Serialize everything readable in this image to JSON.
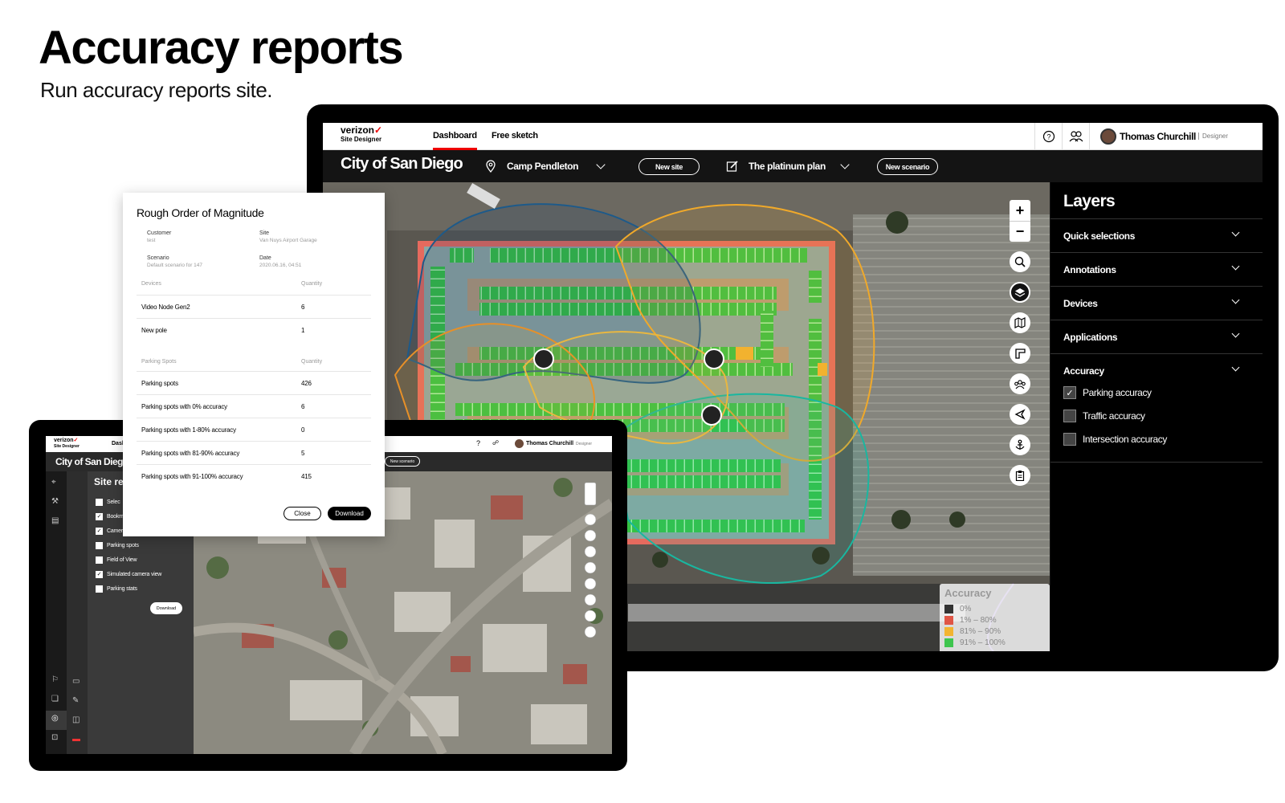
{
  "hero": {
    "title": "Accuracy reports",
    "subtitle": "Run accuracy reports site."
  },
  "main_app": {
    "logo": {
      "brand": "verizon",
      "product": "Site Designer"
    },
    "nav": [
      {
        "label": "Dashboard",
        "active": true
      },
      {
        "label": "Free sketch",
        "active": false
      }
    ],
    "icons": [
      "help-icon",
      "users-icon"
    ],
    "user": {
      "name": "Thomas Churchill",
      "role": "Designer"
    },
    "city": "City of San Diego",
    "site": "Camp Pendleton",
    "new_site_label": "New site",
    "plan": "The platinum plan",
    "new_scenario_label": "New scenario",
    "layers": {
      "title": "Layers",
      "sections": [
        "Quick selections",
        "Annotations",
        "Devices",
        "Applications",
        "Accuracy"
      ],
      "accuracy_options": [
        {
          "label": "Parking accuracy",
          "checked": true
        },
        {
          "label": "Traffic accuracy",
          "checked": false
        },
        {
          "label": "Intersection accuracy",
          "checked": false
        }
      ]
    },
    "legend": {
      "title": "Accuracy",
      "items": [
        {
          "label": "0%",
          "color": "#333333"
        },
        {
          "label": "1% – 80%",
          "color": "#e05545"
        },
        {
          "label": "81% – 90%",
          "color": "#f2b431"
        },
        {
          "label": "91% – 100%",
          "color": "#3ec54e"
        }
      ]
    },
    "map_controls": [
      "zoom-in-icon",
      "zoom-out-icon",
      "search-icon",
      "layers-icon",
      "map-icon",
      "measure-icon",
      "group-icon",
      "navigate-icon",
      "anchor-icon",
      "clipboard-icon"
    ]
  },
  "report": {
    "title": "Rough Order of Magnitude",
    "customer_label": "Customer",
    "customer_value": "test",
    "site_label": "Site",
    "site_value": "Van Nuys Airport Garage",
    "scenario_label": "Scenario",
    "scenario_value": "Default scenario for 147",
    "date_label": "Date",
    "date_value": "2020.06.16, 04:51",
    "devices_header": "Devices",
    "quantity_header": "Quantity",
    "devices": [
      {
        "name": "Video Node Gen2",
        "qty": "6"
      },
      {
        "name": "New pole",
        "qty": "1"
      }
    ],
    "parking_header": "Parking Spots",
    "quantity_header2": "Quantity",
    "parking": [
      {
        "name": "Parking spots",
        "qty": "426"
      },
      {
        "name": "Parking spots with 0% accuracy",
        "qty": "6"
      },
      {
        "name": "Parking spots with 1-80% accuracy",
        "qty": "0"
      },
      {
        "name": "Parking spots with 81-90% accuracy",
        "qty": "5"
      },
      {
        "name": "Parking spots with 91-100% accuracy",
        "qty": "415"
      }
    ],
    "close_label": "Close",
    "download_label": "Download"
  },
  "small_app": {
    "logo": {
      "brand": "verizon",
      "product": "Site Designer"
    },
    "city": "City of San Dieg",
    "nav_partial": "Dash",
    "user": {
      "name": "Thomas Churchill",
      "role": "Designer"
    },
    "new_scenario_label": "New scenario",
    "panel_title": "Site re",
    "options": [
      {
        "label": "Selec",
        "checked": false
      },
      {
        "label": "Bookm",
        "checked": true
      },
      {
        "label": "Camer",
        "checked": true
      },
      {
        "label": "Parking spots",
        "checked": false
      },
      {
        "label": "Field of View",
        "checked": false
      },
      {
        "label": "Simulated camera view",
        "checked": true
      },
      {
        "label": "Parking stats",
        "checked": false
      }
    ],
    "download_label": "Download"
  }
}
